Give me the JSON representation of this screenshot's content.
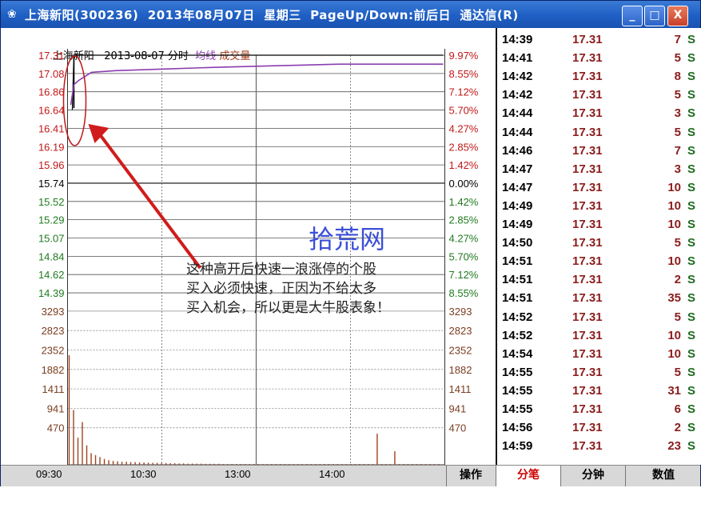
{
  "window": {
    "title": "上海新阳(300236)  2013年08月07日  星期三  PageUp/Down:前后日  通达信(R)",
    "buttons": {
      "minimize": "_",
      "maximize": "□",
      "close": "X"
    }
  },
  "chart_header": {
    "stock": "上海新阳",
    "date_label": "2013-08-07 分时",
    "avg_label": "均线",
    "vol_label": "成交量"
  },
  "chart_data": {
    "type": "line",
    "price_axis_left": [
      "17.31",
      "17.08",
      "16.86",
      "16.64",
      "16.41",
      "16.19",
      "15.96",
      "15.74",
      "15.52",
      "15.29",
      "15.07",
      "14.84",
      "14.62",
      "14.39"
    ],
    "pct_axis_right": [
      "9.97%",
      "8.55%",
      "7.12%",
      "5.70%",
      "4.27%",
      "2.85%",
      "1.42%",
      "0.00%",
      "1.42%",
      "2.85%",
      "4.27%",
      "5.70%",
      "7.12%",
      "8.55%"
    ],
    "volume_axis": [
      "3293",
      "2823",
      "2352",
      "1882",
      "1411",
      "941",
      "470"
    ],
    "x_tick_labels": [
      "09:30",
      "10:30",
      "13:00",
      "14:00"
    ],
    "series": [
      {
        "values": [
          16.64,
          17.31,
          17.31,
          17.31,
          17.31
        ]
      },
      {
        "values": [
          16.7,
          16.95,
          17.0,
          17.1,
          17.12,
          17.14,
          17.16,
          17.18,
          17.2,
          17.2,
          17.2
        ]
      }
    ],
    "volume": [
      2823,
      1411,
      700,
      1100,
      500,
      300,
      250,
      200,
      150,
      120,
      100,
      90,
      80,
      80,
      70,
      70,
      60,
      60,
      55,
      50,
      50,
      45,
      45,
      40,
      40,
      35,
      35,
      30,
      30,
      30,
      30,
      25,
      25,
      25,
      25,
      20,
      20,
      20,
      20,
      20,
      20,
      20,
      20,
      20,
      20,
      20,
      20,
      20,
      20,
      20,
      20,
      20,
      20,
      20,
      20,
      20,
      20,
      20,
      20,
      20,
      20,
      20,
      20,
      20,
      20,
      20,
      20,
      20,
      20,
      20,
      800,
      20,
      20,
      20,
      350,
      20,
      20,
      20,
      20,
      20,
      20,
      20,
      20,
      20,
      20
    ]
  },
  "ticks": [
    {
      "time": "14:39",
      "price": "17.31",
      "vol": "7",
      "side": "S"
    },
    {
      "time": "14:41",
      "price": "17.31",
      "vol": "5",
      "side": "S"
    },
    {
      "time": "14:42",
      "price": "17.31",
      "vol": "8",
      "side": "S"
    },
    {
      "time": "14:42",
      "price": "17.31",
      "vol": "5",
      "side": "S"
    },
    {
      "time": "14:44",
      "price": "17.31",
      "vol": "3",
      "side": "S"
    },
    {
      "time": "14:44",
      "price": "17.31",
      "vol": "5",
      "side": "S"
    },
    {
      "time": "14:46",
      "price": "17.31",
      "vol": "7",
      "side": "S"
    },
    {
      "time": "14:47",
      "price": "17.31",
      "vol": "3",
      "side": "S"
    },
    {
      "time": "14:47",
      "price": "17.31",
      "vol": "10",
      "side": "S"
    },
    {
      "time": "14:49",
      "price": "17.31",
      "vol": "10",
      "side": "S"
    },
    {
      "time": "14:49",
      "price": "17.31",
      "vol": "10",
      "side": "S"
    },
    {
      "time": "14:50",
      "price": "17.31",
      "vol": "5",
      "side": "S"
    },
    {
      "time": "14:51",
      "price": "17.31",
      "vol": "10",
      "side": "S"
    },
    {
      "time": "14:51",
      "price": "17.31",
      "vol": "2",
      "side": "S"
    },
    {
      "time": "14:51",
      "price": "17.31",
      "vol": "35",
      "side": "S"
    },
    {
      "time": "14:52",
      "price": "17.31",
      "vol": "5",
      "side": "S"
    },
    {
      "time": "14:52",
      "price": "17.31",
      "vol": "10",
      "side": "S"
    },
    {
      "time": "14:54",
      "price": "17.31",
      "vol": "10",
      "side": "S"
    },
    {
      "time": "14:55",
      "price": "17.31",
      "vol": "5",
      "side": "S"
    },
    {
      "time": "14:55",
      "price": "17.31",
      "vol": "31",
      "side": "S"
    },
    {
      "time": "14:55",
      "price": "17.31",
      "vol": "6",
      "side": "S"
    },
    {
      "time": "14:56",
      "price": "17.31",
      "vol": "2",
      "side": "S"
    },
    {
      "time": "14:59",
      "price": "17.31",
      "vol": "23",
      "side": "S"
    }
  ],
  "bottom_tabs": [
    "操作",
    "分笔",
    "分钟",
    "数值"
  ],
  "annotation": {
    "watermark": "拾荒网",
    "lines": [
      "这种高开后快速一浪涨停的个股",
      "买入必须快速，正因为不给太多",
      "买入机会，所以更是大牛股表象！"
    ]
  },
  "colors": {
    "price_line": "#000000",
    "avg_line": "#8a3db0",
    "volume": "#a0421f",
    "red": "#c01818",
    "green": "#1f7a1f"
  }
}
